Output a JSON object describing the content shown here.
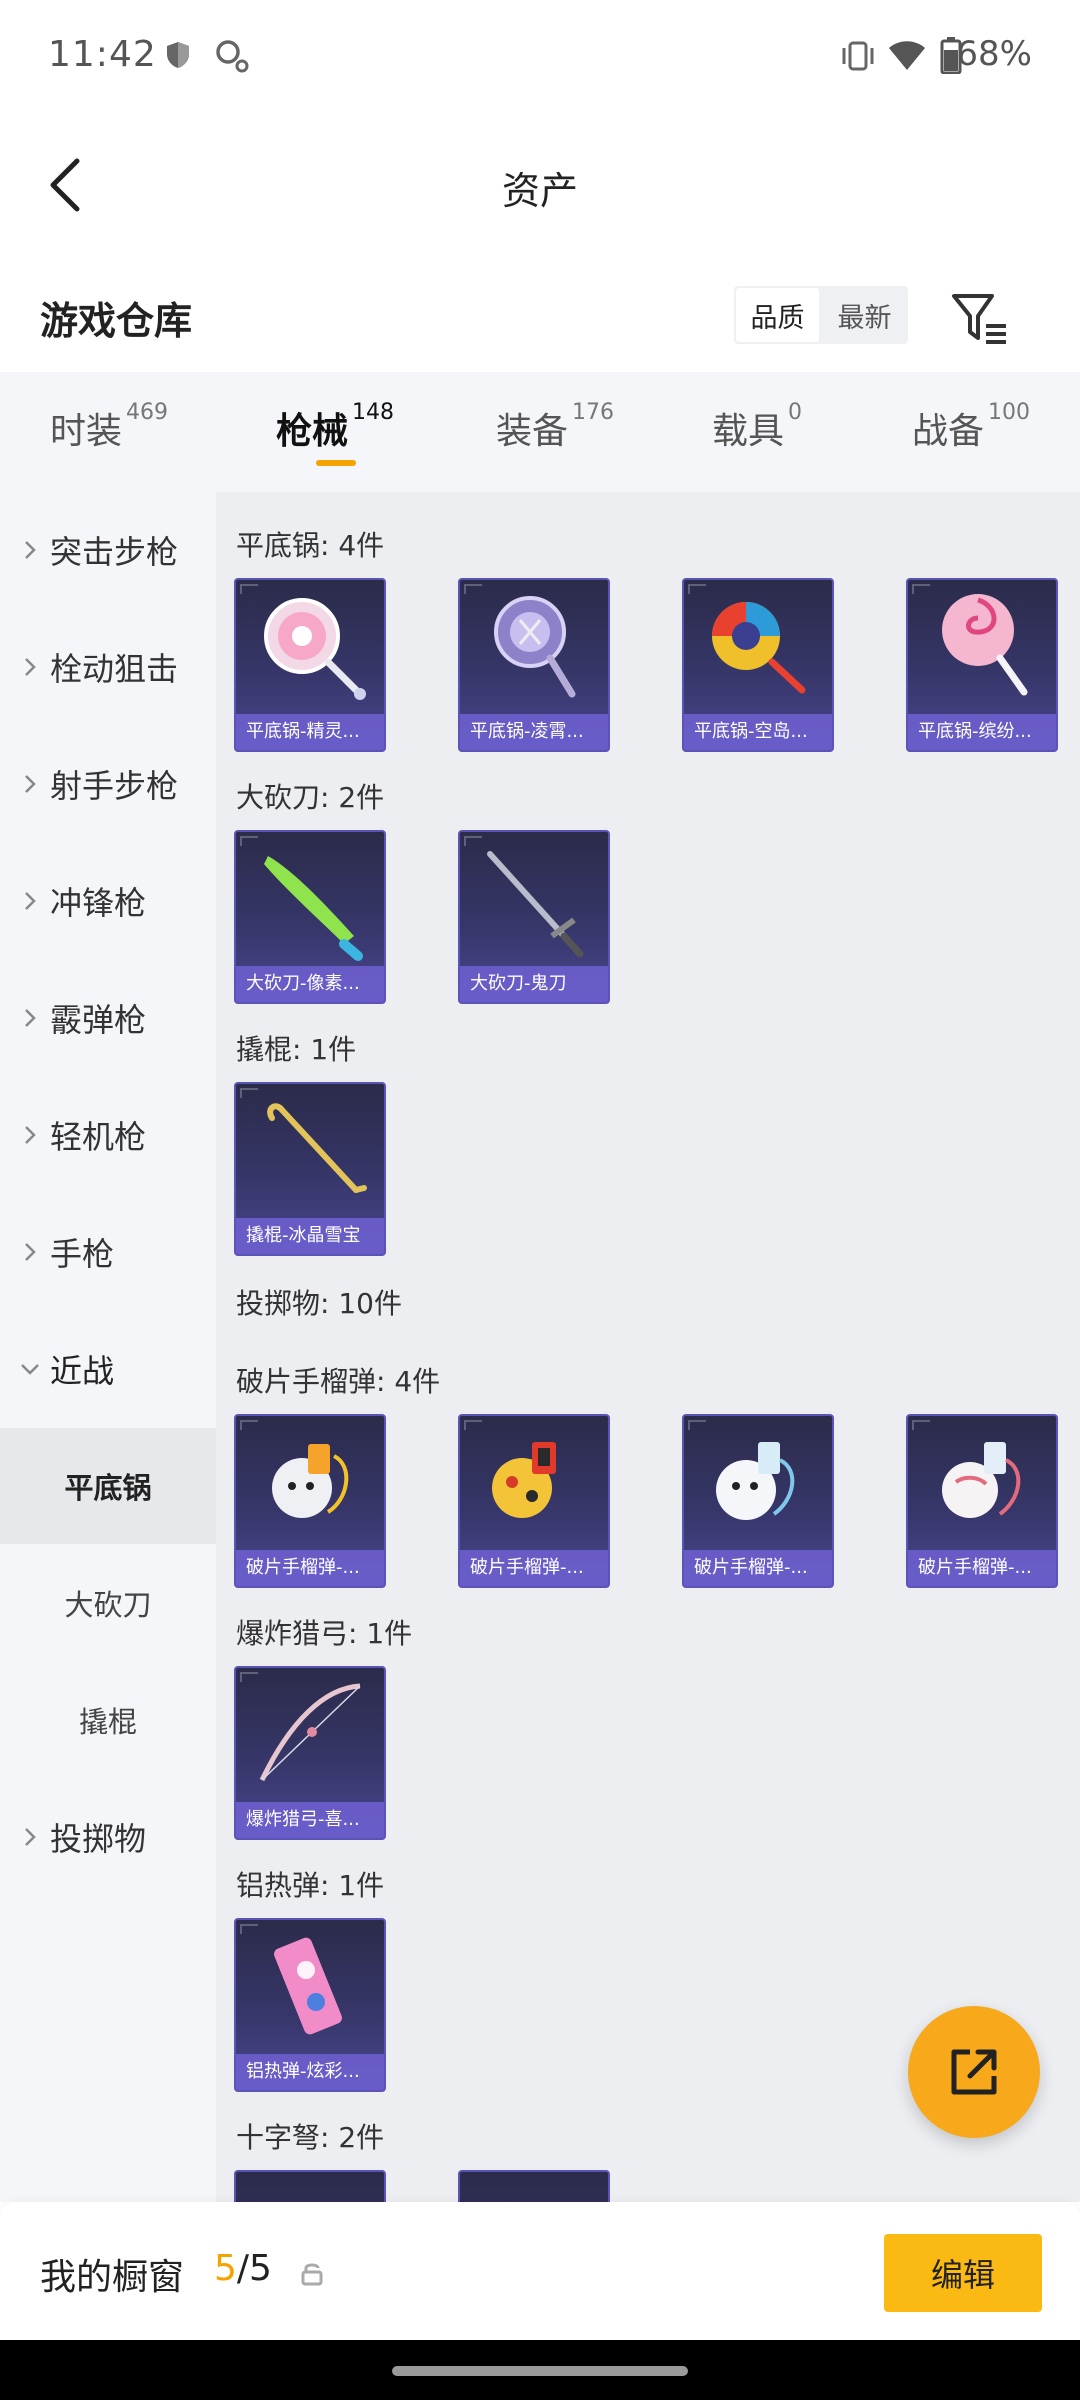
{
  "status_bar": {
    "time": "11:42",
    "battery": "68%"
  },
  "header": {
    "title": "资产"
  },
  "section": {
    "title": "游戏仓库",
    "sort_options": [
      "品质",
      "最新"
    ],
    "active_sort": "品质"
  },
  "tabs": [
    {
      "label": "时装",
      "count": "469"
    },
    {
      "label": "枪械",
      "count": "148",
      "active": true
    },
    {
      "label": "装备",
      "count": "176"
    },
    {
      "label": "载具",
      "count": "0"
    },
    {
      "label": "战备",
      "count": "100"
    }
  ],
  "sidebar": {
    "categories": [
      "突击步枪",
      "栓动狙击",
      "射手步枪",
      "冲锋枪",
      "霰弹枪",
      "轻机枪",
      "手枪",
      "近战"
    ],
    "subcategories": [
      "平底锅",
      "大砍刀",
      "撬棍"
    ],
    "active_sub": "平底锅",
    "last_category": "投掷物"
  },
  "groups": {
    "pan": {
      "label": "平底锅: 4件",
      "items": [
        "平底锅-精灵...",
        "平底锅-凌霄...",
        "平底锅-空岛...",
        "平底锅-缤纷..."
      ]
    },
    "machete": {
      "label": "大砍刀: 2件",
      "items": [
        "大砍刀-像素...",
        "大砍刀-鬼刀"
      ]
    },
    "crowbar": {
      "label": "撬棍: 1件",
      "items": [
        "撬棍-冰晶雪宝"
      ]
    },
    "throwables": {
      "label": "投掷物: 10件"
    },
    "frag": {
      "label": "破片手榴弹: 4件",
      "items": [
        "破片手榴弹-...",
        "破片手榴弹-...",
        "破片手榴弹-...",
        "破片手榴弹-..."
      ]
    },
    "bow": {
      "label": "爆炸猎弓: 1件",
      "items": [
        "爆炸猎弓-喜..."
      ]
    },
    "thermite": {
      "label": "铝热弹: 1件",
      "items": [
        "铝热弹-炫彩..."
      ]
    },
    "crossbow": {
      "label": "十字弩: 2件"
    }
  },
  "bottom_bar": {
    "label": "我的橱窗",
    "current": "5",
    "total": "/5",
    "edit_label": "编辑"
  },
  "colors": {
    "accent": "#f5a300",
    "card_caption": "#6e60d2",
    "fab": "#f7a81b"
  }
}
